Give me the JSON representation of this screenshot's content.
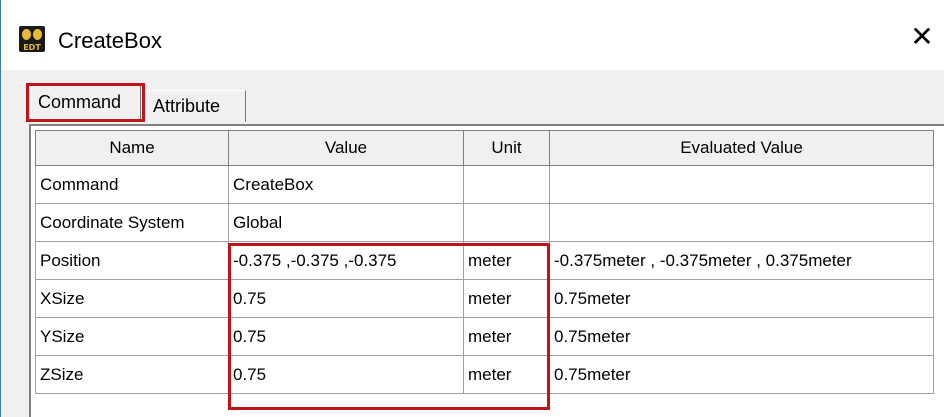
{
  "window": {
    "title": "CreateBox",
    "icon": "edt-app-icon",
    "icon_text": "EDT",
    "close_glyph": "✕"
  },
  "tabs": [
    {
      "label": "Command",
      "active": true
    },
    {
      "label": "Attribute",
      "active": false
    }
  ],
  "table": {
    "headers": {
      "name": "Name",
      "value": "Value",
      "unit": "Unit",
      "evaluated": "Evaluated Value"
    },
    "rows": [
      {
        "name": "Command",
        "value": "CreateBox",
        "unit": "",
        "evaluated": ""
      },
      {
        "name": "Coordinate System",
        "value": "Global",
        "unit": "",
        "evaluated": ""
      },
      {
        "name": "Position",
        "value": "-0.375 ,-0.375 ,-0.375",
        "unit": "meter",
        "evaluated": "-0.375meter , -0.375meter , 0.375meter"
      },
      {
        "name": "XSize",
        "value": "0.75",
        "unit": "meter",
        "evaluated": "0.75meter"
      },
      {
        "name": "YSize",
        "value": "0.75",
        "unit": "meter",
        "evaluated": "0.75meter"
      },
      {
        "name": "ZSize",
        "value": "0.75",
        "unit": "meter",
        "evaluated": "0.75meter"
      }
    ]
  },
  "colors": {
    "highlight": "#c0141b",
    "window_border": "#3c7fb1",
    "panel": "#f0f0f0"
  }
}
